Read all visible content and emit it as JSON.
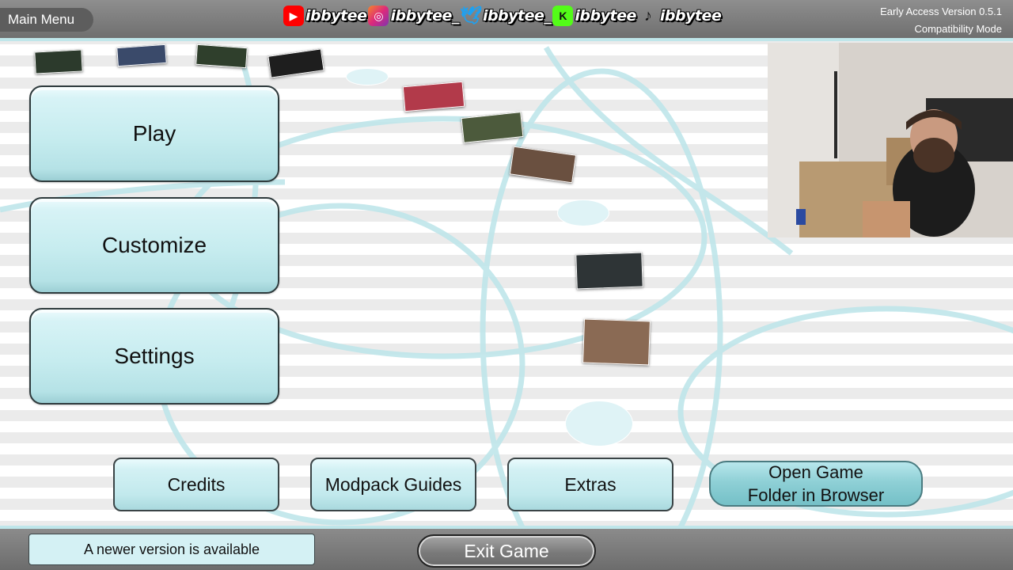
{
  "header": {
    "menu_title": "Main Menu",
    "socials": [
      {
        "platform": "youtube-icon",
        "handle": "ibbytee",
        "color": "#ff0000"
      },
      {
        "platform": "instagram-icon",
        "handle": "ibbytee_",
        "color": "#c13584"
      },
      {
        "platform": "twitter-icon",
        "handle": "ibbytee_",
        "color": "#1da1f2"
      },
      {
        "platform": "kick-icon",
        "handle": "ibbytee",
        "color": "#53fc18"
      },
      {
        "platform": "tiktok-icon",
        "handle": "ibbytee",
        "color": "#111111"
      }
    ],
    "version_line1": "Early Access Version 0.5.1",
    "version_line2": "Compatibility Mode"
  },
  "main_buttons": {
    "play": "Play",
    "customize": "Customize",
    "settings": "Settings"
  },
  "secondary_buttons": {
    "credits": "Credits",
    "modpack_guides": "Modpack Guides",
    "extras": "Extras",
    "open_folder": "Open Game\nFolder in Browser"
  },
  "footer": {
    "update_notice": "A newer version is available",
    "exit": "Exit Game"
  },
  "colors": {
    "accent_cyan": "#bfe6ea",
    "button_fill": "#c6ecef",
    "bar_gray": "#7a7a7a"
  }
}
